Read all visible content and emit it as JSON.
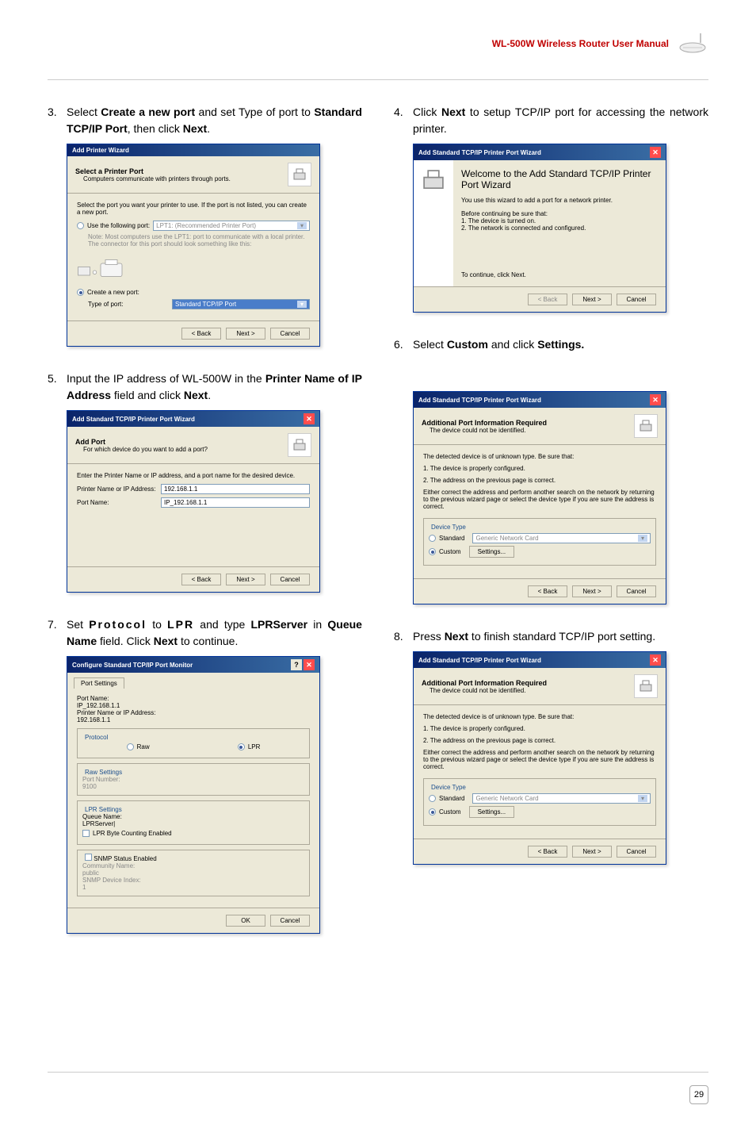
{
  "header": {
    "title": "WL-500W Wireless Router User Manual"
  },
  "page_number": "29",
  "steps": {
    "s3": {
      "num": "3.",
      "text_pre": "Select ",
      "b1": "Create a new port",
      "text_mid": " and set Type of port to ",
      "b2": "Standard TCP/IP Port",
      "text_post": ", then click ",
      "b3": "Next",
      "dot": "."
    },
    "s4": {
      "num": "4.",
      "text_pre": "Click ",
      "b1": "Next",
      "text_mid": " to setup TCP/IP port for accessing the network printer."
    },
    "s5": {
      "num": "5.",
      "text_pre": "Input the IP address of WL-500W in the ",
      "b1": "Printer Name of IP Address",
      "text_mid": " field and click ",
      "b2": "Next",
      "dot": "."
    },
    "s6": {
      "num": "6.",
      "text_pre": "Select ",
      "b1": "Custom",
      "text_mid": " and click ",
      "b2": "Settings."
    },
    "s7": {
      "num": "7.",
      "text_pre": "Set ",
      "b1": "Protocol",
      "text_mid1": " to ",
      "b2": "LPR",
      "text_mid2": " and type ",
      "b3": "LPRServer",
      "text_mid3": " in ",
      "b4": "Queue Name",
      "text_mid4": " field. Click ",
      "b5": "Next",
      "text_post": " to continue."
    },
    "s8": {
      "num": "8.",
      "text_pre": "Press ",
      "b1": "Next",
      "text_post": " to finish standard TCP/IP port setting."
    }
  },
  "dlg3": {
    "title": "Add Printer Wizard",
    "head_t": "Select a Printer Port",
    "head_s": "Computers communicate with printers through ports.",
    "body_intro": "Select the port you want your printer to use. If the port is not listed, you can create a new port.",
    "opt_use": "Use the following port:",
    "port_val": "LPT1: (Recommended Printer Port)",
    "note": "Note: Most computers use the LPT1: port to communicate with a local printer. The connector for this port should look something like this:",
    "opt_create": "Create a new port:",
    "type_label": "Type of port:",
    "type_val": "Standard TCP/IP Port",
    "back": "< Back",
    "next": "Next >",
    "cancel": "Cancel"
  },
  "dlg4": {
    "title": "Add Standard TCP/IP Printer Port Wizard",
    "welcome_t": "Welcome to the Add Standard TCP/IP Printer Port Wizard",
    "welcome_p1": "You use this wizard to add a port for a network printer.",
    "welcome_p2": "Before continuing be sure that:",
    "welcome_l1": "1. The device is turned on.",
    "welcome_l2": "2. The network is connected and configured.",
    "welcome_p3": "To continue, click Next.",
    "back": "< Back",
    "next": "Next >",
    "cancel": "Cancel"
  },
  "dlg5": {
    "title": "Add Standard TCP/IP Printer Port Wizard",
    "head_t": "Add Port",
    "head_s": "For which device do you want to add a port?",
    "body_intro": "Enter the Printer Name or IP address, and a port name for the desired device.",
    "f1_label": "Printer Name or IP Address:",
    "f1_val": "192.168.1.1",
    "f2_label": "Port Name:",
    "f2_val": "IP_192.168.1.1",
    "back": "< Back",
    "next": "Next >",
    "cancel": "Cancel"
  },
  "dlg6": {
    "title": "Add Standard TCP/IP Printer Port Wizard",
    "head_t": "Additional Port Information Required",
    "head_s": "The device could not be identified.",
    "body_p1": "The detected device is of unknown type. Be sure that:",
    "body_l1": "1. The device is properly configured.",
    "body_l2": "2. The address on the previous page is correct.",
    "body_p2": "Either correct the address and perform another search on the network by returning to the previous wizard page or select the device type if you are sure the address is correct.",
    "fs_legend": "Device Type",
    "opt_std": "Standard",
    "std_val": "Generic Network Card",
    "opt_custom": "Custom",
    "settings_btn": "Settings...",
    "back": "< Back",
    "next": "Next >",
    "cancel": "Cancel"
  },
  "dlg7": {
    "title": "Configure Standard TCP/IP Port Monitor",
    "tab": "Port Settings",
    "f1_label": "Port Name:",
    "f1_val": "IP_192.168.1.1",
    "f2_label": "Printer Name or IP Address:",
    "f2_val": "192.168.1.1",
    "fs_proto": "Protocol",
    "opt_raw": "Raw",
    "opt_lpr": "LPR",
    "fs_raw": "Raw Settings",
    "raw_port_label": "Port Number:",
    "raw_port_val": "9100",
    "fs_lpr": "LPR Settings",
    "queue_label": "Queue Name:",
    "queue_val": "LPRServer|",
    "chk_lpr": "LPR Byte Counting Enabled",
    "fs_snmp": "SNMP Status Enabled",
    "comm_label": "Community Name:",
    "comm_val": "public",
    "idx_label": "SNMP Device Index:",
    "idx_val": "1",
    "ok": "OK",
    "cancel": "Cancel"
  },
  "dlg8": {
    "title": "Add Standard TCP/IP Printer Port Wizard",
    "head_t": "Additional Port Information Required",
    "head_s": "The device could not be identified.",
    "body_p1": "The detected device is of unknown type. Be sure that:",
    "body_l1": "1. The device is properly configured.",
    "body_l2": "2. The address on the previous page is correct.",
    "body_p2": "Either correct the address and perform another search on the network by returning to the previous wizard page or select the device type if you are sure the address is correct.",
    "fs_legend": "Device Type",
    "opt_std": "Standard",
    "std_val": "Generic Network Card",
    "opt_custom": "Custom",
    "settings_btn": "Settings...",
    "back": "< Back",
    "next": "Next >",
    "cancel": "Cancel"
  }
}
